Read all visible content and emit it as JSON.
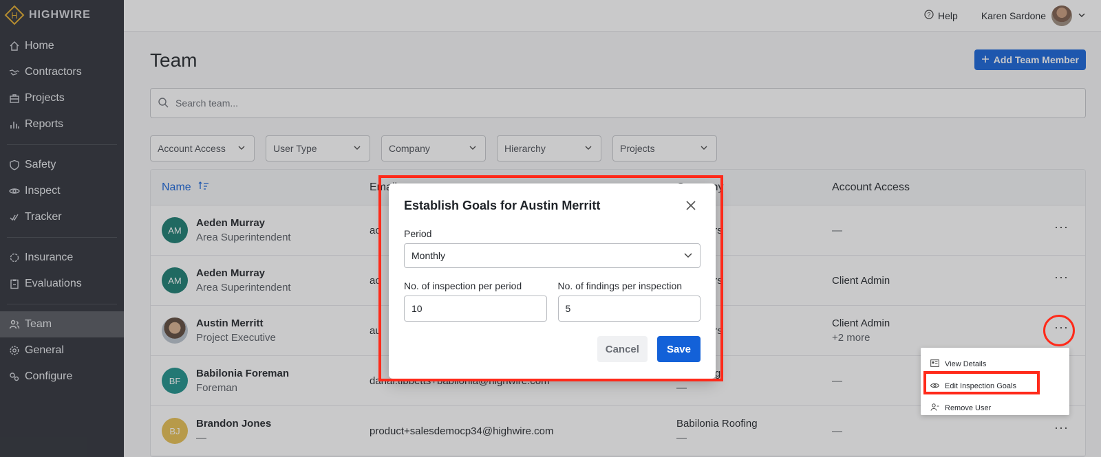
{
  "brand": {
    "name": "HIGHWIRE",
    "mark_letter": "H",
    "color": "#e0a92a"
  },
  "sidebar": {
    "groups": [
      [
        {
          "label": "Home",
          "icon": "home-icon"
        },
        {
          "label": "Contractors",
          "icon": "handshake-icon"
        },
        {
          "label": "Projects",
          "icon": "briefcase-icon"
        },
        {
          "label": "Reports",
          "icon": "bar-chart-icon"
        }
      ],
      [
        {
          "label": "Safety",
          "icon": "shield-icon"
        },
        {
          "label": "Inspect",
          "icon": "eye-icon"
        },
        {
          "label": "Tracker",
          "icon": "check-double-icon"
        }
      ],
      [
        {
          "label": "Insurance",
          "icon": "gear-badge-icon"
        },
        {
          "label": "Evaluations",
          "icon": "clipboard-icon"
        }
      ],
      [
        {
          "label": "Team",
          "icon": "users-icon",
          "active": true
        },
        {
          "label": "General",
          "icon": "gear-icon"
        },
        {
          "label": "Configure",
          "icon": "settings-link-icon"
        }
      ]
    ]
  },
  "topbar": {
    "help_label": "Help",
    "user_name": "Karen Sardone"
  },
  "page": {
    "title": "Team",
    "add_button": "Add Team Member",
    "search_placeholder": "Search team..."
  },
  "filters": [
    "Account Access",
    "User Type",
    "Company",
    "Hierarchy",
    "Projects"
  ],
  "table": {
    "headers": {
      "name": "Name",
      "email": "Email",
      "company": "Company",
      "access": "Account Access"
    },
    "rows": [
      {
        "initials": "AM",
        "color": "#157a6e",
        "name": "Aeden Murray",
        "role": "Area Superintendent",
        "email": "ac",
        "company": "e Builders",
        "access": "—",
        "access_more": ""
      },
      {
        "initials": "AM",
        "color": "#157a6e",
        "name": "Aeden Murray",
        "role": "Area Superintendent",
        "email": "ac",
        "company": "e Builders",
        "access": "Client Admin",
        "access_more": ""
      },
      {
        "initials": "",
        "color": "#8a7a6a",
        "name": "Austin Merritt",
        "role": "Project Executive",
        "email": "au",
        "company": "e Builders",
        "access": "Client Admin",
        "access_more": "+2 more"
      },
      {
        "initials": "BF",
        "color": "#1a8f88",
        "name": "Babilonia Foreman",
        "role": "Foreman",
        "email": "danai.tibbetts+babilonia@highwire.com",
        "company": "a Roofing",
        "company_sub": "—",
        "access": "—",
        "access_more": ""
      },
      {
        "initials": "BJ",
        "color": "#e6be4e",
        "name": "Brandon Jones",
        "role": "—",
        "email": "product+salesdemocp34@highwire.com",
        "company": "Babilonia Roofing",
        "company_sub": "—",
        "access": "—",
        "access_more": ""
      }
    ]
  },
  "modal": {
    "title": "Establish Goals for Austin Merritt",
    "period_label": "Period",
    "period_value": "Monthly",
    "inspections_label": "No. of inspection per period",
    "inspections_value": "10",
    "findings_label": "No. of findings per inspection",
    "findings_value": "5",
    "cancel": "Cancel",
    "save": "Save"
  },
  "context_menu": [
    "View Details",
    "Edit Inspection Goals",
    "Remove User"
  ],
  "annotation_color": "#ff2a1a"
}
